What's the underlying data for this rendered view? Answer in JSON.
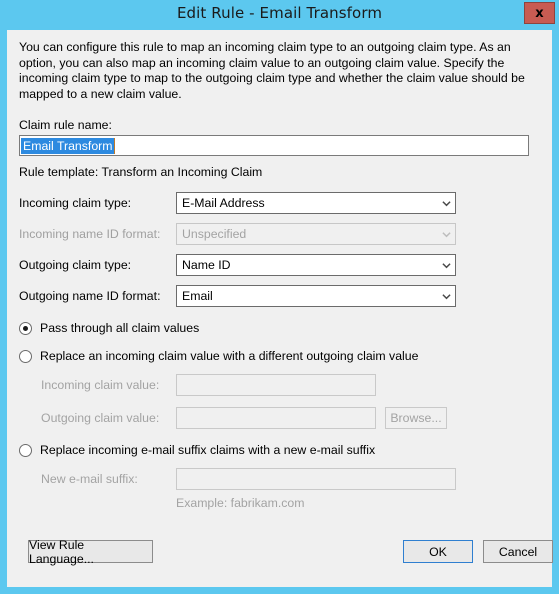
{
  "window": {
    "title": "Edit Rule - Email Transform",
    "close_label": "x",
    "accent_titlebar": "#5cc8ef",
    "close_button_color": "#c75b52",
    "client_background": "#f0f0f0"
  },
  "description": "You can configure this rule to map an incoming claim type to an outgoing claim type. As an option, you can also map an incoming claim value to an outgoing claim value. Specify the incoming claim type to map to the outgoing claim type and whether the claim value should be mapped to a new claim value.",
  "claim_rule_name": {
    "label": "Claim rule name:",
    "value": "Email Transform",
    "selection_color": "#2d8ae0"
  },
  "rule_template_line": "Rule template: Transform an Incoming Claim",
  "fields": [
    {
      "label": "Incoming claim type:",
      "value": "E-Mail Address",
      "disabled": false
    },
    {
      "label": "Incoming name ID format:",
      "value": "Unspecified",
      "disabled": true
    },
    {
      "label": "Outgoing claim type:",
      "value": "Name ID",
      "disabled": false
    },
    {
      "label": "Outgoing name ID format:",
      "value": "Email",
      "disabled": false
    }
  ],
  "options": {
    "pass_through": {
      "label": "Pass through all claim values",
      "selected": true
    },
    "replace_value": {
      "label": "Replace an incoming claim value with a different outgoing claim value",
      "selected": false
    },
    "replace_suffix": {
      "label": "Replace incoming e-mail suffix claims with a new e-mail suffix",
      "selected": false
    }
  },
  "replace_value_fields": {
    "incoming_label": "Incoming claim value:",
    "incoming_value": "",
    "outgoing_label": "Outgoing claim value:",
    "outgoing_value": "",
    "browse_label": "Browse..."
  },
  "replace_suffix_fields": {
    "suffix_label": "New e-mail suffix:",
    "suffix_value": "",
    "example": "Example: fabrikam.com"
  },
  "footer": {
    "view_rule_language": "View Rule Language...",
    "ok": "OK",
    "cancel": "Cancel"
  }
}
